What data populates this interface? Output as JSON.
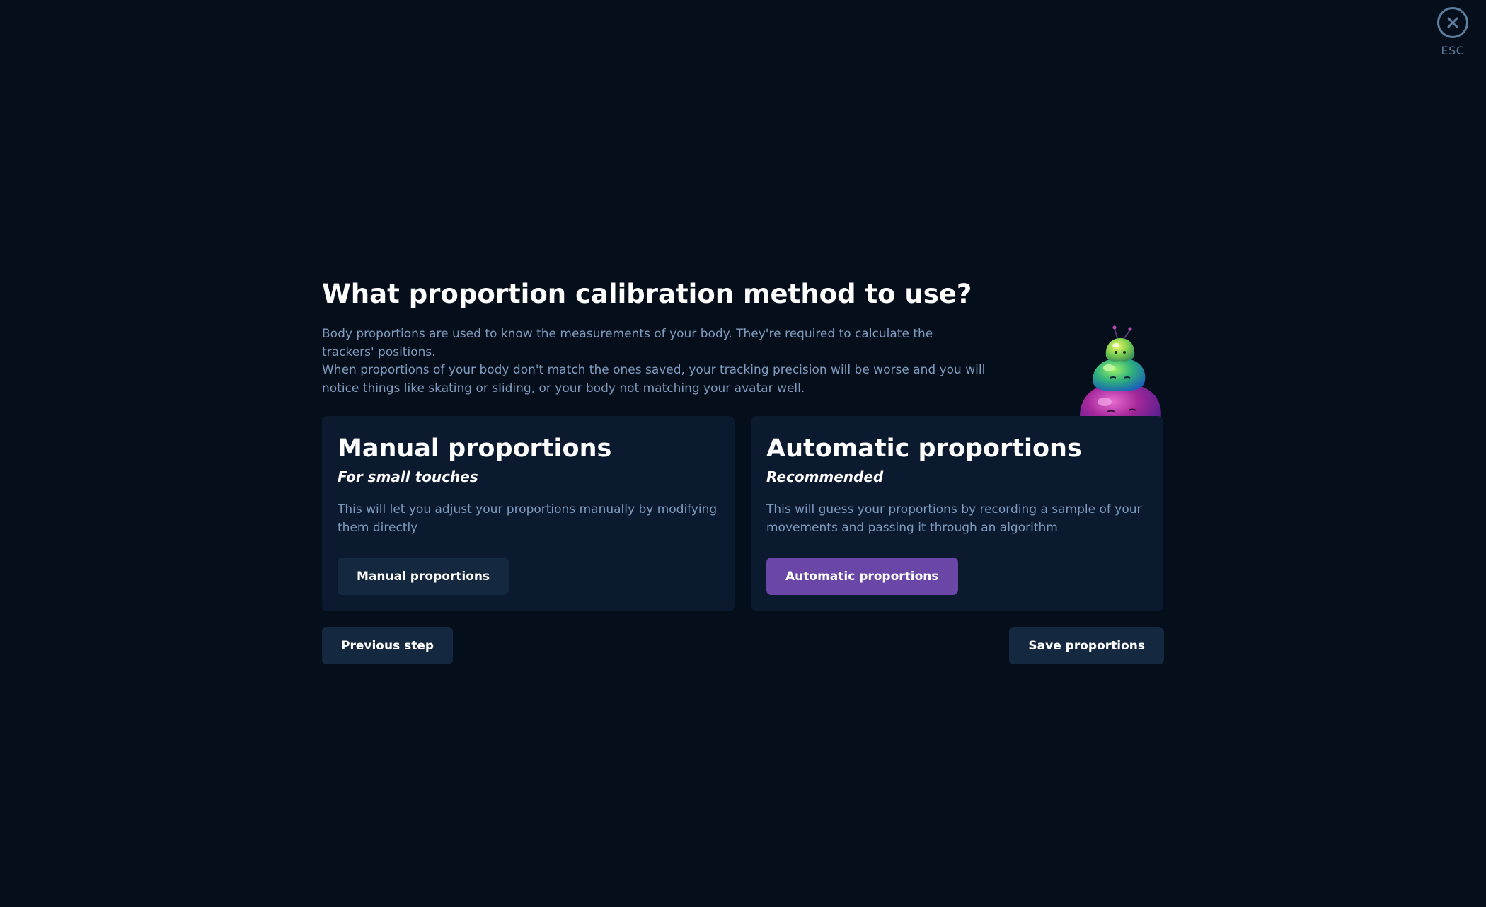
{
  "close": {
    "label": "ESC",
    "icon": "close-icon"
  },
  "header": {
    "title": "What proportion calibration method to use?",
    "description_lines": [
      "Body proportions are used to know the measurements of your body. They're required to calculate the trackers' positions.",
      "When proportions of your body don't match the ones saved, your tracking precision will be worse and you will notice things like skating or sliding, or your body not matching your avatar well."
    ]
  },
  "mascot": {
    "icon": "slime-stack-mascot"
  },
  "cards": {
    "manual": {
      "title": "Manual proportions",
      "subtitle": "For small touches",
      "text": "This will let you adjust your proportions manually by modifying them directly",
      "button_label": "Manual proportions"
    },
    "automatic": {
      "title": "Automatic proportions",
      "subtitle": "Recommended",
      "text": "This will guess your proportions by recording a sample of your movements and passing it through an algorithm",
      "button_label": "Automatic proportions"
    }
  },
  "footer": {
    "previous_label": "Previous step",
    "save_label": "Save proportions"
  },
  "colors": {
    "background": "#040f1b",
    "card": "#0b1a2e",
    "button_dark": "#14283f",
    "accent_purple": "#6a47a6",
    "muted_text": "#7f9bbd"
  }
}
